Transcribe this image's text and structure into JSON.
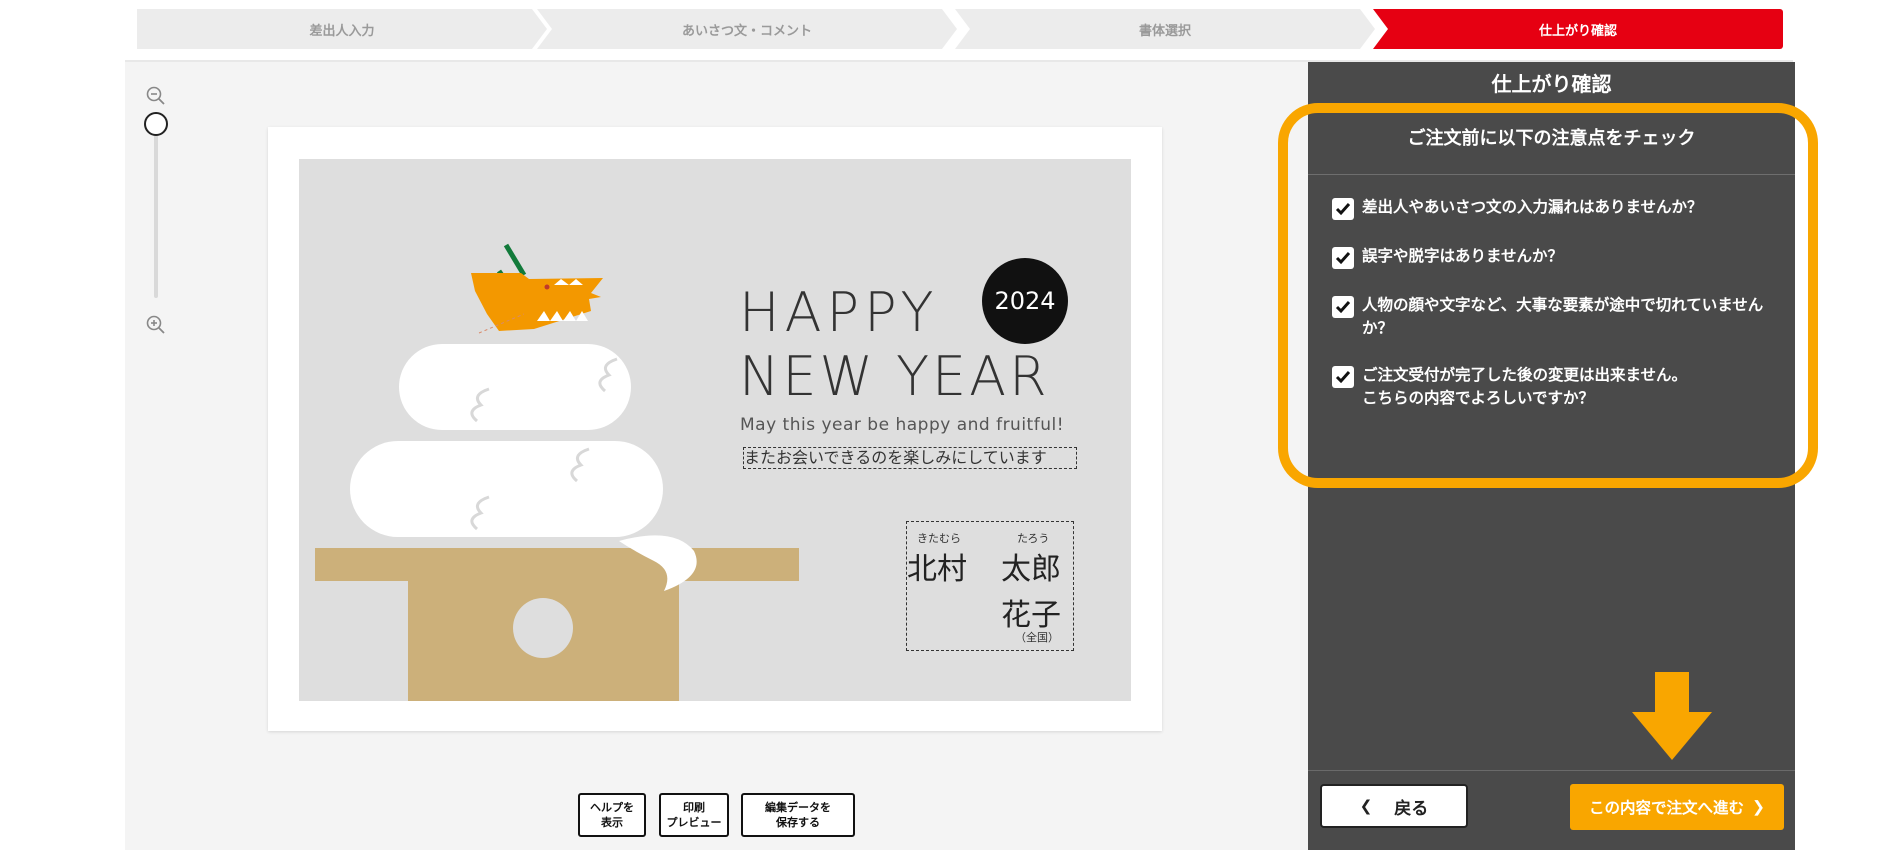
{
  "steps": [
    {
      "label": "差出人入力"
    },
    {
      "label": "あいさつ文・コメント"
    },
    {
      "label": "書体選択"
    },
    {
      "label": "仕上がり確認"
    }
  ],
  "card": {
    "happy": "HAPPY",
    "new_year": "NEW YEAR",
    "year": "2024",
    "subtitle": "May this year be happy and fruitful!",
    "greeting": "またお会いできるのを楽しみにしています",
    "ruby_surname": "きたむら",
    "ruby_given": "たろう",
    "surname": "北村",
    "given1": "太郎",
    "given2": "花子",
    "region": "（全国）"
  },
  "zoom": {
    "level": 0
  },
  "panel": {
    "title": "仕上がり確認",
    "check_heading": "ご注文前に以下の注意点をチェック",
    "items": [
      {
        "text": "差出人やあいさつ文の入力漏れはありませんか？",
        "checked": true
      },
      {
        "text": "誤字や脱字はありませんか？",
        "checked": true
      },
      {
        "text": "人物の顔や文字など、大事な要素が途中で切れていませんか？",
        "checked": true
      },
      {
        "text": "ご注文受付が完了した後の変更は出来ません。",
        "text2": "こちらの内容でよろしいですか？",
        "checked": true
      }
    ],
    "back_label": "戻る",
    "next_label": "この内容で注文へ進む"
  },
  "tools": {
    "help": [
      "ヘルプを",
      "表示"
    ],
    "preview": [
      "印刷",
      "プレビュー"
    ],
    "save": [
      "編集データを",
      "保存する"
    ]
  },
  "colors": {
    "accent": "#e60012",
    "highlight": "#f9a600",
    "panel": "#4a4a4a"
  }
}
